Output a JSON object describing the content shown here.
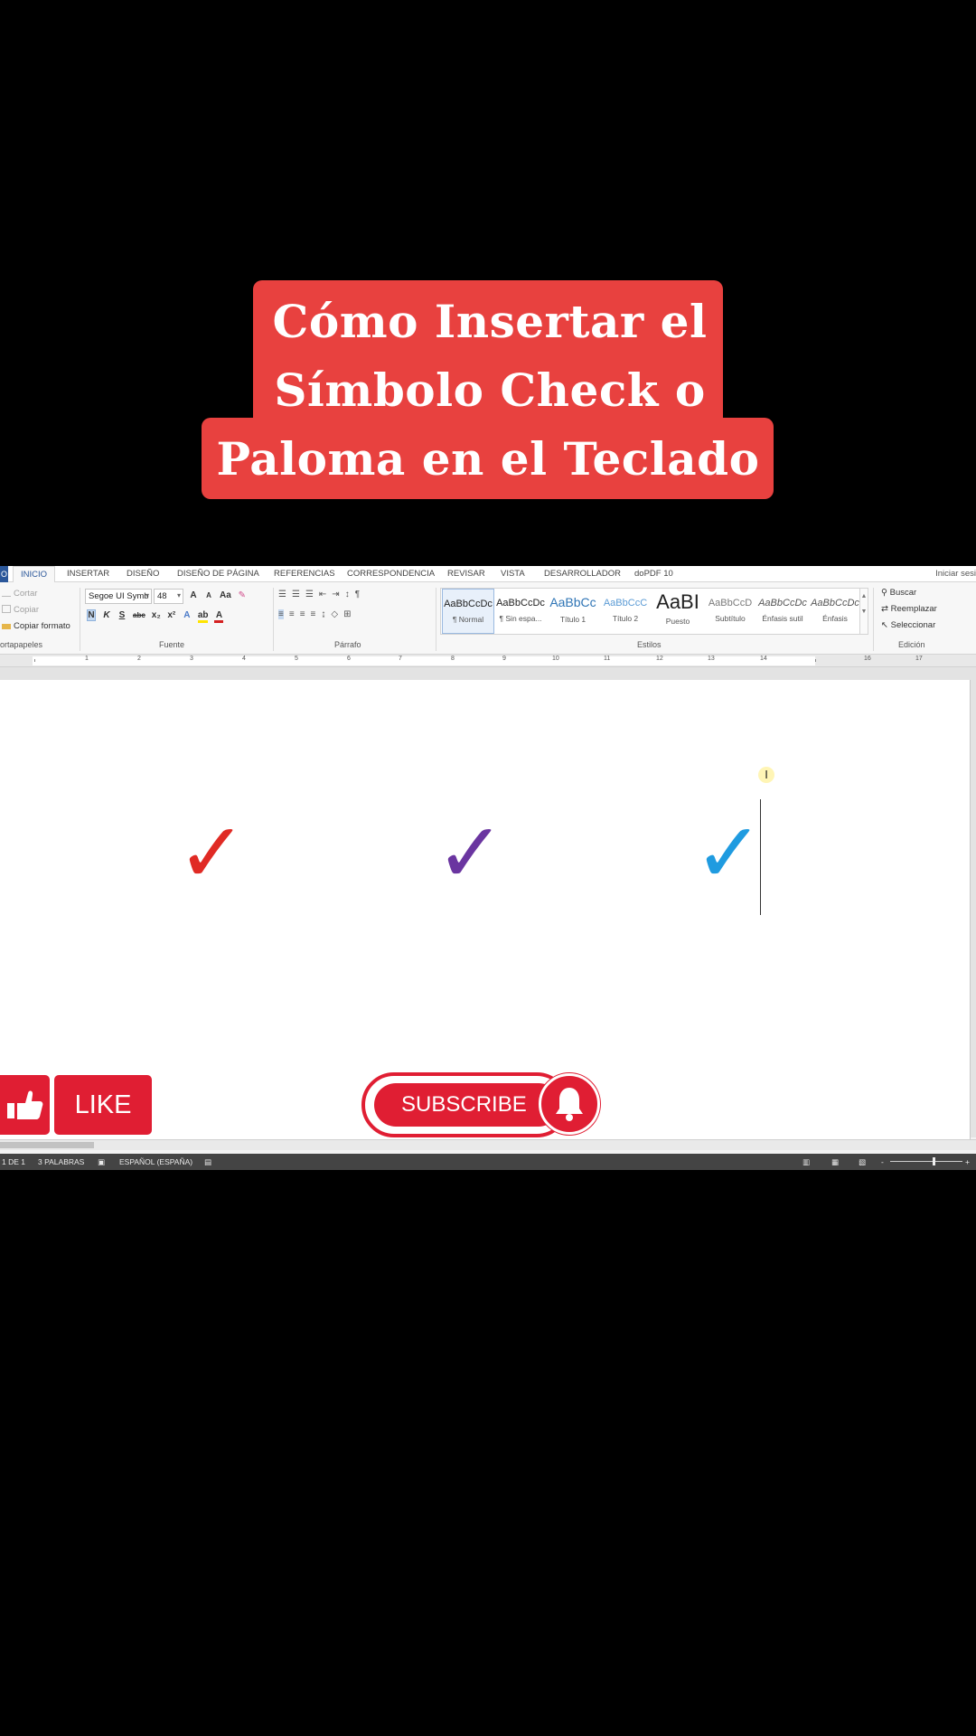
{
  "title": {
    "line1": "Cómo Insertar el",
    "line2": "Símbolo Check o",
    "line3": "Paloma en el Teclado"
  },
  "word": {
    "file_tab": "O",
    "tabs": [
      "INICIO",
      "INSERTAR",
      "DISEÑO",
      "DISEÑO DE PÁGINA",
      "REFERENCIAS",
      "CORRESPONDENCIA",
      "REVISAR",
      "VISTA",
      "DESARROLLADOR",
      "doPDF 10"
    ],
    "signin": "Iniciar sesi",
    "clipboard": {
      "cut": "Cortar",
      "copy": "Copiar",
      "format_painter": "Copiar formato",
      "label": "ortapapeles"
    },
    "font": {
      "name": "Segoe UI Symb",
      "size": "48",
      "grow": "A",
      "shrink": "A",
      "case": "Aa",
      "bold": "N",
      "italic": "K",
      "underline": "S",
      "strike": "abc",
      "subscript": "x₂",
      "superscript": "x²",
      "label": "Fuente"
    },
    "paragraph_label": "Párrafo",
    "styles": {
      "items": [
        {
          "sample": "AaBbCcDc",
          "name": "¶ Normal"
        },
        {
          "sample": "AaBbCcDc",
          "name": "¶ Sin espa..."
        },
        {
          "sample": "AaBbCc",
          "name": "Título 1"
        },
        {
          "sample": "AaBbCcC",
          "name": "Título 2"
        },
        {
          "sample": "AaBI",
          "name": "Puesto"
        },
        {
          "sample": "AaBbCcD",
          "name": "Subtítulo"
        },
        {
          "sample": "AaBbCcDc",
          "name": "Énfasis sutil"
        },
        {
          "sample": "AaBbCcDc",
          "name": "Énfasis"
        }
      ],
      "label": "Estilos"
    },
    "editing": {
      "find": "Buscar",
      "replace": "Reemplazar",
      "select": "Seleccionar",
      "label": "Edición"
    },
    "ruler_numbers": [
      "1",
      "2",
      "3",
      "4",
      "5",
      "6",
      "7",
      "8",
      "9",
      "10",
      "11",
      "12",
      "13",
      "14",
      "16",
      "17"
    ],
    "document": {
      "checks": [
        {
          "glyph": "✓",
          "color": "#e02a24"
        },
        {
          "glyph": "✓",
          "color": "#6a35a0"
        },
        {
          "glyph": "✓",
          "color": "#1f9be0"
        }
      ],
      "ibeam": "I"
    },
    "overlay": {
      "like": "LIKE",
      "subscribe": "SUBSCRIBE"
    },
    "status": {
      "page": "1 DE 1",
      "words": "3 PALABRAS",
      "language": "ESPAÑOL (ESPAÑA)"
    }
  },
  "colors": {
    "title_bg": "#e8413f",
    "accent": "#2b579a",
    "youtube_red": "#e01e33"
  }
}
